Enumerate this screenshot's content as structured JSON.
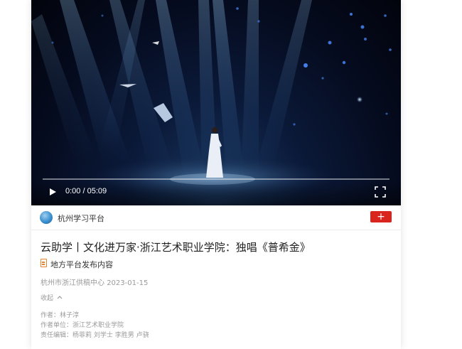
{
  "video": {
    "time_display": "0:00 / 05:09",
    "progress_fraction": 0
  },
  "publisher": {
    "name": "杭州学习平台",
    "follow_label": "+",
    "follow_color": "#d9251d"
  },
  "article": {
    "title": "云助学丨文化进万家·浙江艺术职业学院：独唱《普希金》",
    "source_label": "地方平台发布内容",
    "source_icon": "document-icon",
    "source_icon_color": "#e8812b",
    "publisher_line": "杭州市浙江供稿中心",
    "date": "2023-01-15",
    "collapse_label": "收起",
    "author_label": "作者：",
    "author": "林子淳",
    "unit_label": "作者单位：",
    "unit": "浙江艺术职业学院",
    "editor_label": "责任编辑：",
    "editors": "杨菲莉 刘学士 李胜男 卢骁"
  }
}
